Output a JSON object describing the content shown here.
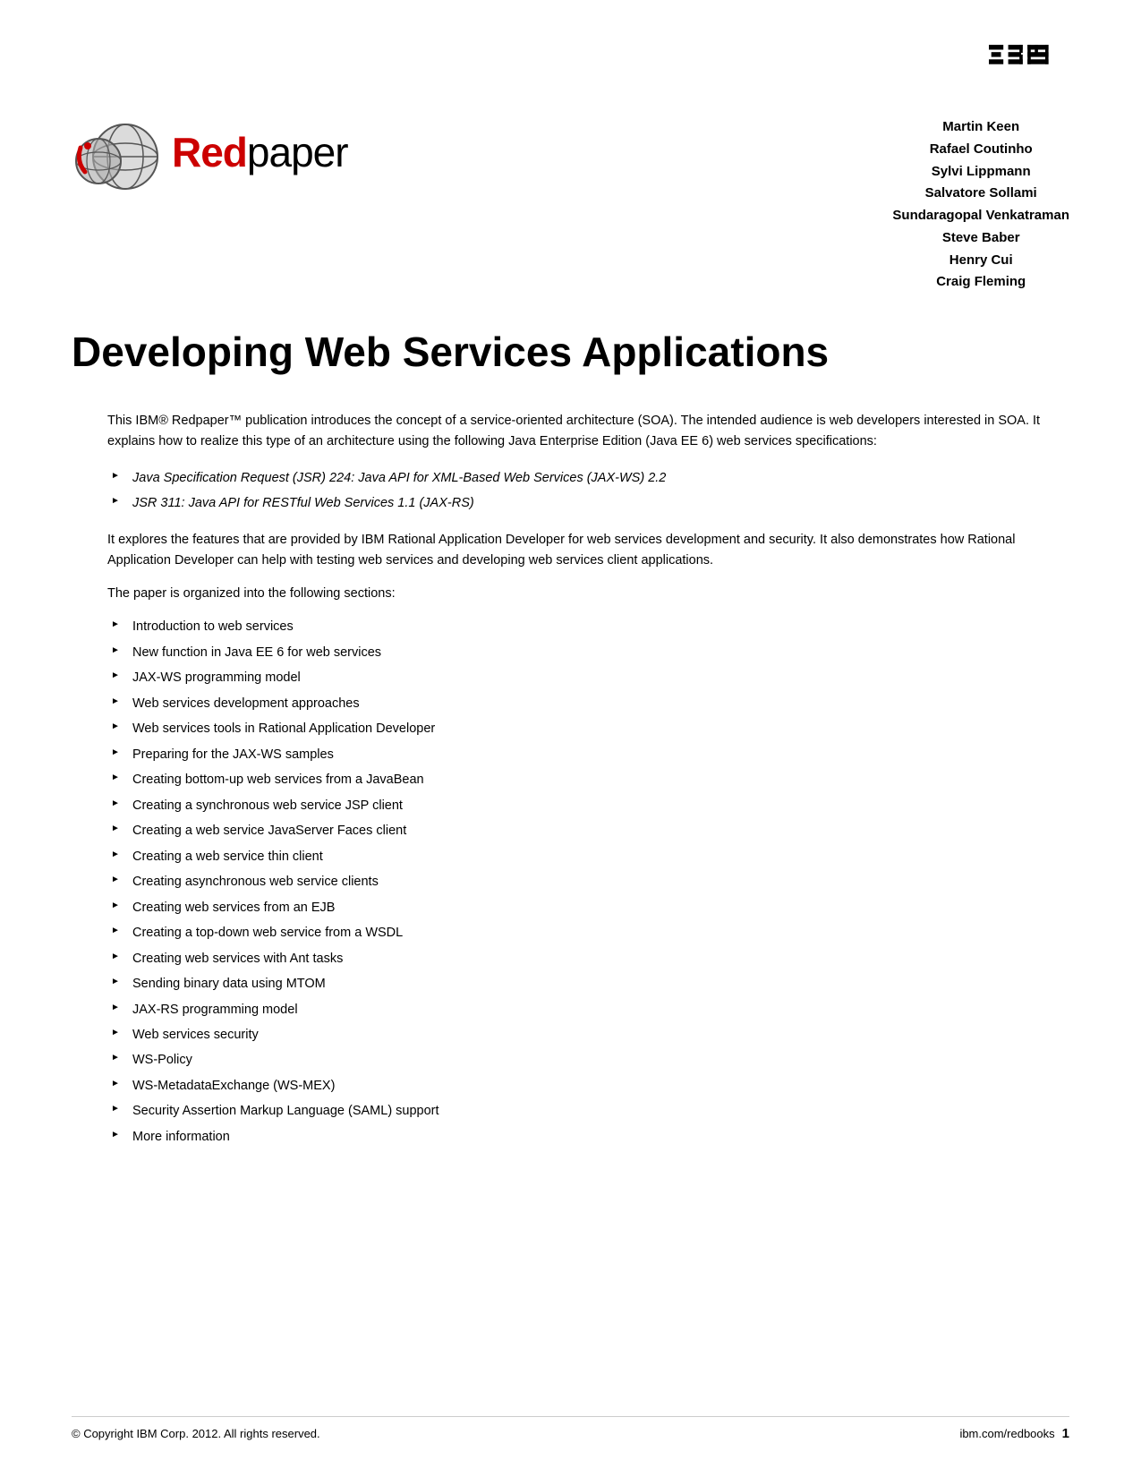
{
  "ibm_logo": {
    "alt": "IBM Logo"
  },
  "redpaper": {
    "red_text": "Red",
    "black_text": "paper",
    "logo_alt": "Redpaper globe logo"
  },
  "authors": {
    "list": [
      "Martin Keen",
      "Rafael Coutinho",
      "Sylvi Lippmann",
      "Salvatore Sollami",
      "Sundaragopal Venkatraman",
      "Steve Baber",
      "Henry Cui",
      "Craig Fleming"
    ]
  },
  "title": "Developing Web Services Applications",
  "intro_paragraph": "This IBM® Redpaper™ publication introduces the concept of a service-oriented architecture (SOA). The intended audience is web developers interested in SOA. It explains how to realize this type of an architecture using the following Java Enterprise Edition (Java EE 6) web services specifications:",
  "spec_bullets": [
    "Java Specification Request (JSR) 224: Java API for XML-Based Web Services (JAX-WS) 2.2",
    "JSR 311: Java API for RESTful Web Services 1.1 (JAX-RS)"
  ],
  "explore_paragraph": "It explores the features that are provided by IBM Rational Application Developer for web services development and security. It also demonstrates how Rational Application Developer can help with testing web services and developing web services client applications.",
  "organized_label": "The paper is organized into the following sections:",
  "sections_list": [
    "Introduction to web services",
    "New function in Java EE 6 for web services",
    "JAX-WS programming model",
    "Web services development approaches",
    "Web services tools in Rational Application Developer",
    "Preparing for the JAX-WS samples",
    "Creating bottom-up web services from a JavaBean",
    "Creating a synchronous web service JSP client",
    "Creating a web service JavaServer Faces client",
    "Creating a web service thin client",
    "Creating asynchronous web service clients",
    "Creating web services from an EJB",
    "Creating a top-down web service from a WSDL",
    "Creating web services with Ant tasks",
    "Sending binary data using MTOM",
    "JAX-RS programming model",
    "Web services security",
    "WS-Policy",
    "WS-MetadataExchange (WS-MEX)",
    "Security Assertion Markup Language (SAML) support",
    "More information"
  ],
  "footer": {
    "copyright": "© Copyright IBM Corp. 2012.  All rights reserved.",
    "website": "ibm.com/redbooks",
    "page_number": "1"
  }
}
